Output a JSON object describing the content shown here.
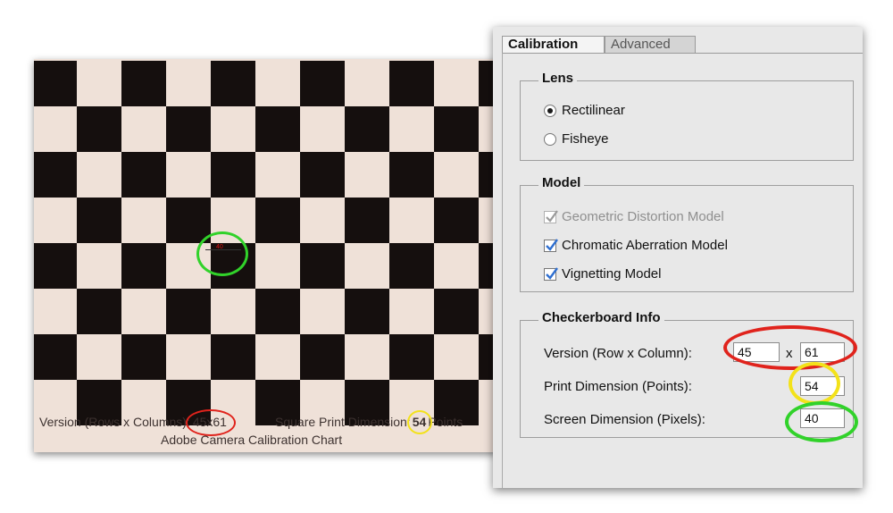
{
  "chart": {
    "sample_pixels": "40",
    "version_label": "Version (Rows x Columns):",
    "version_value": "45x61",
    "square_label": "Square Print Dimension:",
    "square_value": "54",
    "square_unit": "Points",
    "title": "Adobe Camera Calibration Chart"
  },
  "tabs": [
    {
      "label": "Calibration",
      "active": true
    },
    {
      "label": "Advanced",
      "active": false
    }
  ],
  "lens": {
    "title": "Lens",
    "options": [
      {
        "label": "Rectilinear",
        "selected": true
      },
      {
        "label": "Fisheye",
        "selected": false
      }
    ]
  },
  "model": {
    "title": "Model",
    "options": [
      {
        "label": "Geometric Distortion Model",
        "checked": true,
        "enabled": false
      },
      {
        "label": "Chromatic Aberration Model",
        "checked": true,
        "enabled": true
      },
      {
        "label": "Vignetting Model",
        "checked": true,
        "enabled": true
      }
    ]
  },
  "checkerboard": {
    "title": "Checkerboard Info",
    "version_label": "Version (Row x Column):",
    "rows": "45",
    "separator": "x",
    "columns": "61",
    "print_label": "Print Dimension (Points):",
    "print_value": "54",
    "screen_label": "Screen Dimension (Pixels):",
    "screen_value": "40"
  },
  "colors": {
    "highlight_red": "#e0231c",
    "highlight_yellow": "#f3e21a",
    "highlight_green": "#31d22a",
    "check_blue": "#2f6fd0"
  }
}
